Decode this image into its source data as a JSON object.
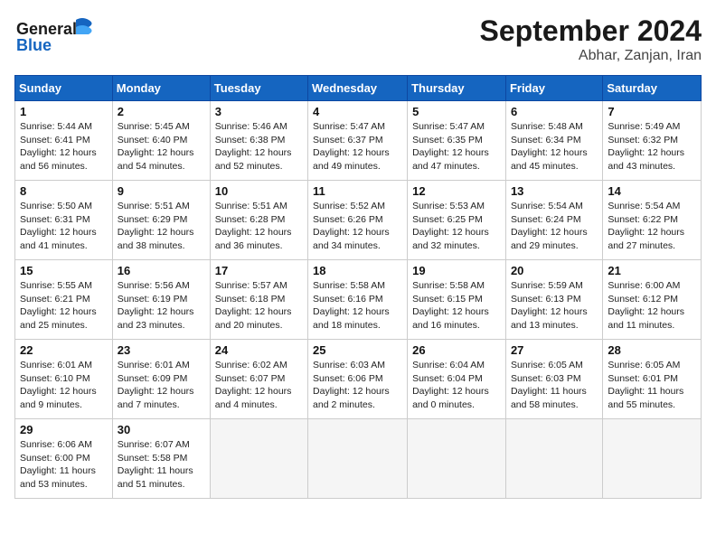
{
  "header": {
    "logo_line1": "General",
    "logo_line2": "Blue",
    "month": "September 2024",
    "location": "Abhar, Zanjan, Iran"
  },
  "days_of_week": [
    "Sunday",
    "Monday",
    "Tuesday",
    "Wednesday",
    "Thursday",
    "Friday",
    "Saturday"
  ],
  "weeks": [
    [
      {
        "day": 1,
        "details": "Sunrise: 5:44 AM\nSunset: 6:41 PM\nDaylight: 12 hours\nand 56 minutes."
      },
      {
        "day": 2,
        "details": "Sunrise: 5:45 AM\nSunset: 6:40 PM\nDaylight: 12 hours\nand 54 minutes."
      },
      {
        "day": 3,
        "details": "Sunrise: 5:46 AM\nSunset: 6:38 PM\nDaylight: 12 hours\nand 52 minutes."
      },
      {
        "day": 4,
        "details": "Sunrise: 5:47 AM\nSunset: 6:37 PM\nDaylight: 12 hours\nand 49 minutes."
      },
      {
        "day": 5,
        "details": "Sunrise: 5:47 AM\nSunset: 6:35 PM\nDaylight: 12 hours\nand 47 minutes."
      },
      {
        "day": 6,
        "details": "Sunrise: 5:48 AM\nSunset: 6:34 PM\nDaylight: 12 hours\nand 45 minutes."
      },
      {
        "day": 7,
        "details": "Sunrise: 5:49 AM\nSunset: 6:32 PM\nDaylight: 12 hours\nand 43 minutes."
      }
    ],
    [
      {
        "day": 8,
        "details": "Sunrise: 5:50 AM\nSunset: 6:31 PM\nDaylight: 12 hours\nand 41 minutes."
      },
      {
        "day": 9,
        "details": "Sunrise: 5:51 AM\nSunset: 6:29 PM\nDaylight: 12 hours\nand 38 minutes."
      },
      {
        "day": 10,
        "details": "Sunrise: 5:51 AM\nSunset: 6:28 PM\nDaylight: 12 hours\nand 36 minutes."
      },
      {
        "day": 11,
        "details": "Sunrise: 5:52 AM\nSunset: 6:26 PM\nDaylight: 12 hours\nand 34 minutes."
      },
      {
        "day": 12,
        "details": "Sunrise: 5:53 AM\nSunset: 6:25 PM\nDaylight: 12 hours\nand 32 minutes."
      },
      {
        "day": 13,
        "details": "Sunrise: 5:54 AM\nSunset: 6:24 PM\nDaylight: 12 hours\nand 29 minutes."
      },
      {
        "day": 14,
        "details": "Sunrise: 5:54 AM\nSunset: 6:22 PM\nDaylight: 12 hours\nand 27 minutes."
      }
    ],
    [
      {
        "day": 15,
        "details": "Sunrise: 5:55 AM\nSunset: 6:21 PM\nDaylight: 12 hours\nand 25 minutes."
      },
      {
        "day": 16,
        "details": "Sunrise: 5:56 AM\nSunset: 6:19 PM\nDaylight: 12 hours\nand 23 minutes."
      },
      {
        "day": 17,
        "details": "Sunrise: 5:57 AM\nSunset: 6:18 PM\nDaylight: 12 hours\nand 20 minutes."
      },
      {
        "day": 18,
        "details": "Sunrise: 5:58 AM\nSunset: 6:16 PM\nDaylight: 12 hours\nand 18 minutes."
      },
      {
        "day": 19,
        "details": "Sunrise: 5:58 AM\nSunset: 6:15 PM\nDaylight: 12 hours\nand 16 minutes."
      },
      {
        "day": 20,
        "details": "Sunrise: 5:59 AM\nSunset: 6:13 PM\nDaylight: 12 hours\nand 13 minutes."
      },
      {
        "day": 21,
        "details": "Sunrise: 6:00 AM\nSunset: 6:12 PM\nDaylight: 12 hours\nand 11 minutes."
      }
    ],
    [
      {
        "day": 22,
        "details": "Sunrise: 6:01 AM\nSunset: 6:10 PM\nDaylight: 12 hours\nand 9 minutes."
      },
      {
        "day": 23,
        "details": "Sunrise: 6:01 AM\nSunset: 6:09 PM\nDaylight: 12 hours\nand 7 minutes."
      },
      {
        "day": 24,
        "details": "Sunrise: 6:02 AM\nSunset: 6:07 PM\nDaylight: 12 hours\nand 4 minutes."
      },
      {
        "day": 25,
        "details": "Sunrise: 6:03 AM\nSunset: 6:06 PM\nDaylight: 12 hours\nand 2 minutes."
      },
      {
        "day": 26,
        "details": "Sunrise: 6:04 AM\nSunset: 6:04 PM\nDaylight: 12 hours\nand 0 minutes."
      },
      {
        "day": 27,
        "details": "Sunrise: 6:05 AM\nSunset: 6:03 PM\nDaylight: 11 hours\nand 58 minutes."
      },
      {
        "day": 28,
        "details": "Sunrise: 6:05 AM\nSunset: 6:01 PM\nDaylight: 11 hours\nand 55 minutes."
      }
    ],
    [
      {
        "day": 29,
        "details": "Sunrise: 6:06 AM\nSunset: 6:00 PM\nDaylight: 11 hours\nand 53 minutes."
      },
      {
        "day": 30,
        "details": "Sunrise: 6:07 AM\nSunset: 5:58 PM\nDaylight: 11 hours\nand 51 minutes."
      },
      null,
      null,
      null,
      null,
      null
    ]
  ]
}
